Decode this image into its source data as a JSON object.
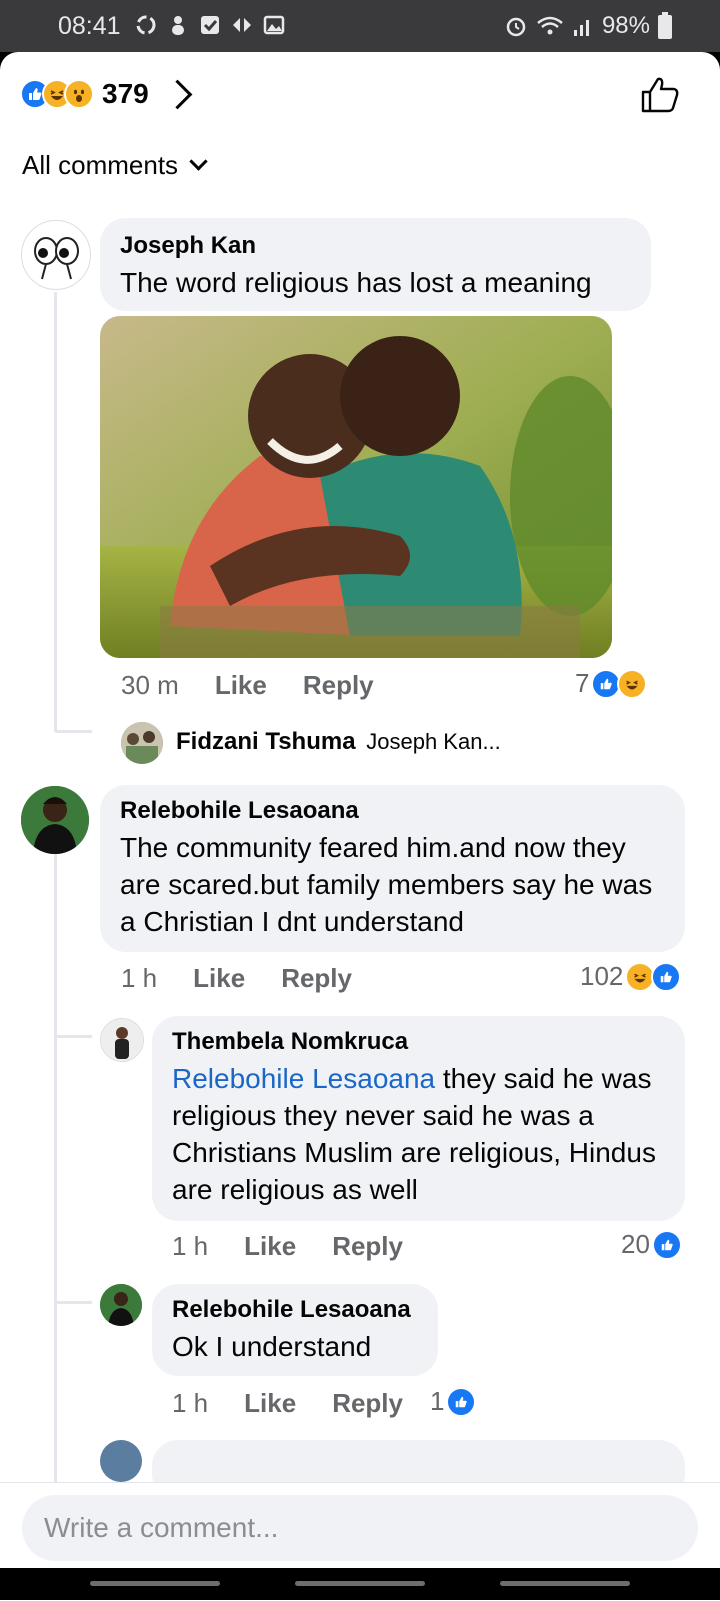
{
  "status": {
    "time": "08:41",
    "battery": "98%"
  },
  "reactions": {
    "count": "379"
  },
  "filter": {
    "label": "All comments"
  },
  "comments": [
    {
      "author": "Joseph Kan",
      "text": "The word religious has lost a meaning",
      "time": "30 m",
      "like": "Like",
      "reply": "Reply",
      "reactions": "7"
    },
    {
      "author": "Relebohile Lesaoana",
      "text": "The community  feared him.and now they are scared.but family members say he was a Christian I dnt understand",
      "time": "1 h",
      "like": "Like",
      "reply": "Reply",
      "reactions": "102"
    }
  ],
  "reply_preview": {
    "author": "Fidzani Tshuma",
    "text": "Joseph Kan..."
  },
  "replies": [
    {
      "author": "Thembela Nomkruca",
      "mention": "Relebohile Lesaoana",
      "text": "they said he was religious they never said he was a Christians Muslim are religious, Hindus are religious as well",
      "time": "1 h",
      "like": "Like",
      "reply": "Reply",
      "reactions": "20"
    },
    {
      "author": "Relebohile Lesaoana",
      "text": "Ok I understand",
      "time": "1 h",
      "like": "Like",
      "reply": "Reply",
      "reactions": "1"
    }
  ],
  "composer": {
    "placeholder": "Write a comment..."
  },
  "colors": {
    "like_blue": "#1877f2",
    "haha_yellow": "#f7b125",
    "mention_blue": "#1a67c9",
    "bubble": "#f0f2f5"
  }
}
